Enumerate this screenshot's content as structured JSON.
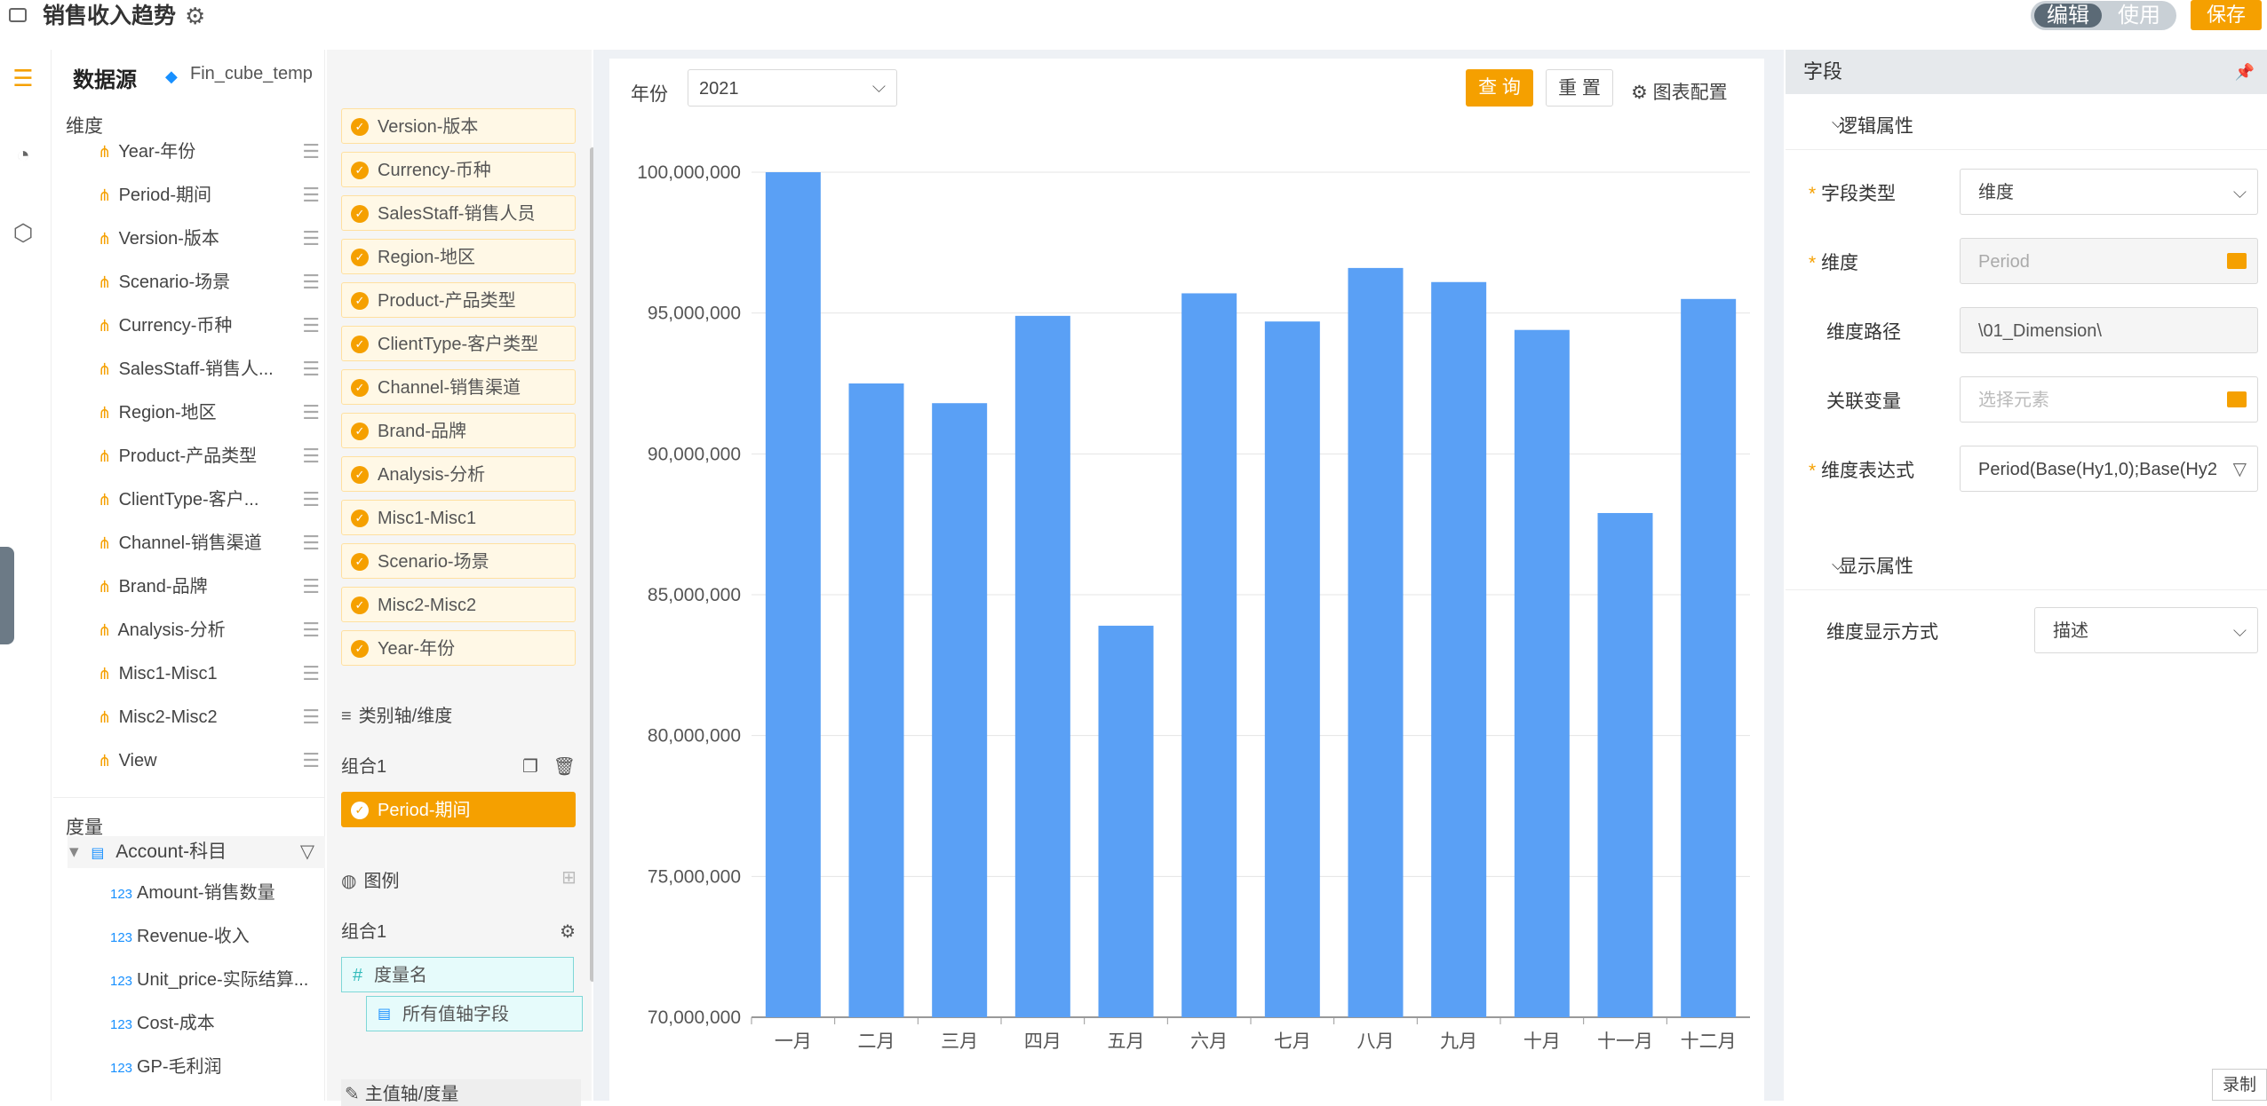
{
  "header": {
    "title": "销售收入趋势",
    "edit_label": "编辑",
    "use_label": "使用",
    "save_label": "保存"
  },
  "datasource": {
    "title": "数据源",
    "cube_name": "Fin_cube_temp",
    "dimensions_label": "维度",
    "dimensions": [
      "Year-年份",
      "Period-期间",
      "Version-版本",
      "Scenario-场景",
      "Currency-币种",
      "SalesStaff-销售人...",
      "Region-地区",
      "Product-产品类型",
      "ClientType-客户...",
      "Channel-销售渠道",
      "Brand-品牌",
      "Analysis-分析",
      "Misc1-Misc1",
      "Misc2-Misc2",
      "View"
    ],
    "measures_label": "度量",
    "account": "Account-科目",
    "measures": [
      "Amount-销售数量",
      "Revenue-收入",
      "Unit_price-实际结算...",
      "Cost-成本",
      "GP-毛利润"
    ],
    "measure_badge": "123"
  },
  "filters": {
    "chips": [
      "Version-版本",
      "Currency-币种",
      "SalesStaff-销售人员",
      "Region-地区",
      "Product-产品类型",
      "ClientType-客户类型",
      "Channel-销售渠道",
      "Brand-品牌",
      "Analysis-分析",
      "Misc1-Misc1",
      "Scenario-场景",
      "Misc2-Misc2",
      "Year-年份"
    ],
    "category_axis_label": "类别轴/维度",
    "group1_label": "组合1",
    "category_chip": "Period-期间",
    "legend_label": "图例",
    "group2_label": "组合1",
    "measure_name_chip": "度量名",
    "all_value_fields": "所有值轴字段",
    "value_axis_label": "主值轴/度量"
  },
  "toolbar": {
    "year_label": "年份",
    "year_value": "2021",
    "query_label": "查 询",
    "reset_label": "重 置",
    "config_label": "图表配置"
  },
  "chart_data": {
    "type": "bar",
    "categories": [
      "一月",
      "二月",
      "三月",
      "四月",
      "五月",
      "六月",
      "七月",
      "八月",
      "九月",
      "十月",
      "十一月",
      "十二月"
    ],
    "values": [
      100000000,
      92500000,
      91800000,
      94900000,
      83900000,
      95700000,
      94700000,
      96600000,
      96100000,
      94400000,
      87900000,
      95500000
    ],
    "ylim": [
      70000000,
      100000000
    ],
    "yticks": [
      "70,000,000",
      "75,000,000",
      "80,000,000",
      "85,000,000",
      "90,000,000",
      "95,000,000",
      "100,000,000"
    ],
    "ytick_values": [
      70000000,
      75000000,
      80000000,
      85000000,
      90000000,
      95000000,
      100000000
    ],
    "grid": true,
    "bar_color": "#5aa0f5"
  },
  "props": {
    "title": "字段",
    "logic_section": "逻辑属性",
    "field_type_label": "字段类型",
    "field_type_value": "维度",
    "dimension_label": "维度",
    "dimension_value": "Period",
    "path_label": "维度路径",
    "path_value": "\\01_Dimension\\",
    "variable_label": "关联变量",
    "variable_placeholder": "选择元素",
    "expr_label": "维度表达式",
    "expr_value": "Period(Base(Hy1,0);Base(Hy2",
    "display_section": "显示属性",
    "display_mode_label": "维度显示方式",
    "display_mode_value": "描述",
    "required_mark": "*"
  },
  "recording_label": "录制"
}
